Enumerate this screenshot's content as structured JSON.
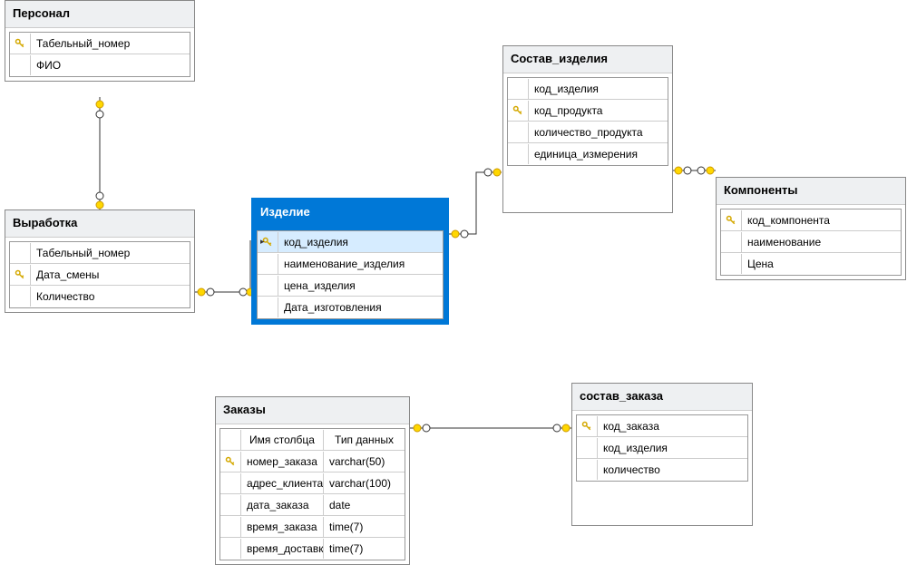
{
  "entities": {
    "personal": {
      "title": "Персонал",
      "fields": [
        {
          "name": "Табельный_номер",
          "key": true
        },
        {
          "name": "ФИО",
          "key": false
        }
      ]
    },
    "vyrabotka": {
      "title": "Выработка",
      "fields": [
        {
          "name": "Табельный_номер",
          "key": false
        },
        {
          "name": "Дата_смены",
          "key": true
        },
        {
          "name": "Количество",
          "key": false
        }
      ]
    },
    "izdelie": {
      "title": "Изделие",
      "fields": [
        {
          "name": "код_изделия",
          "key": true
        },
        {
          "name": "наименование_изделия",
          "key": false
        },
        {
          "name": "цена_изделия",
          "key": false
        },
        {
          "name": "Дата_изготовления",
          "key": false
        }
      ]
    },
    "sostav_izdeliya": {
      "title": "Состав_изделия",
      "fields": [
        {
          "name": "код_изделия",
          "key": false
        },
        {
          "name": "код_продукта",
          "key": true
        },
        {
          "name": "количество_продукта",
          "key": false
        },
        {
          "name": "единица_измерения",
          "key": false
        }
      ]
    },
    "komponenty": {
      "title": "Компоненты",
      "fields": [
        {
          "name": "код_компонента",
          "key": true
        },
        {
          "name": "наименование",
          "key": false
        },
        {
          "name": "Цена",
          "key": false
        }
      ]
    },
    "zakazy": {
      "title": "Заказы",
      "header": {
        "col1": "Имя столбца",
        "col2": "Тип данных"
      },
      "fields": [
        {
          "name": "номер_заказа",
          "type": "varchar(50)",
          "key": true
        },
        {
          "name": "адрес_клиента",
          "type": "varchar(100)",
          "key": false
        },
        {
          "name": "дата_заказа",
          "type": "date",
          "key": false
        },
        {
          "name": "время_заказа",
          "type": "time(7)",
          "key": false
        },
        {
          "name": "время_доставки",
          "type": "time(7)",
          "key": false
        }
      ]
    },
    "sostav_zakaza": {
      "title": "состав_заказа",
      "fields": [
        {
          "name": "код_заказа",
          "key": true
        },
        {
          "name": "код_изделия",
          "key": false
        },
        {
          "name": "количество",
          "key": false
        }
      ]
    }
  }
}
